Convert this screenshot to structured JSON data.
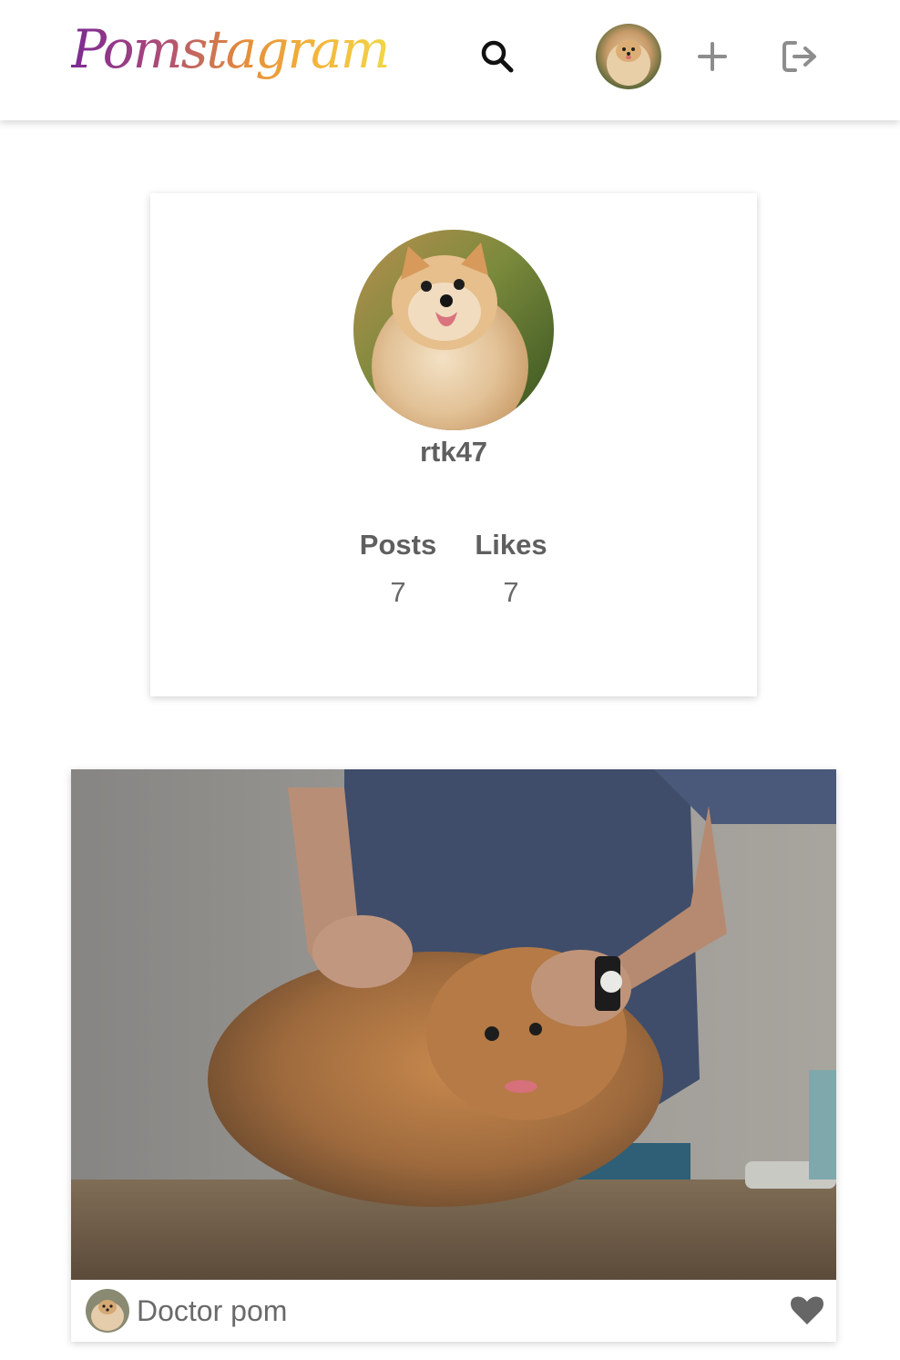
{
  "app": {
    "logo_text": "Pomstagram",
    "brand_gradient": [
      "#7b2a93",
      "#a6457d",
      "#e58f39",
      "#f4b63a",
      "#f1d64a"
    ]
  },
  "nav": {
    "icons": [
      "search-icon",
      "user-avatar",
      "plus-icon",
      "logout-icon"
    ]
  },
  "profile": {
    "username": "rtk47",
    "stats": [
      {
        "label": "Posts",
        "value": "7"
      },
      {
        "label": "Likes",
        "value": "7"
      }
    ]
  },
  "post": {
    "caption": "Doctor pom",
    "like_icon": "heart-icon",
    "liked": true
  },
  "colors": {
    "text_primary": "#5f5f5f",
    "icon_gray": "#8d8d8d",
    "heart": "#666666"
  }
}
